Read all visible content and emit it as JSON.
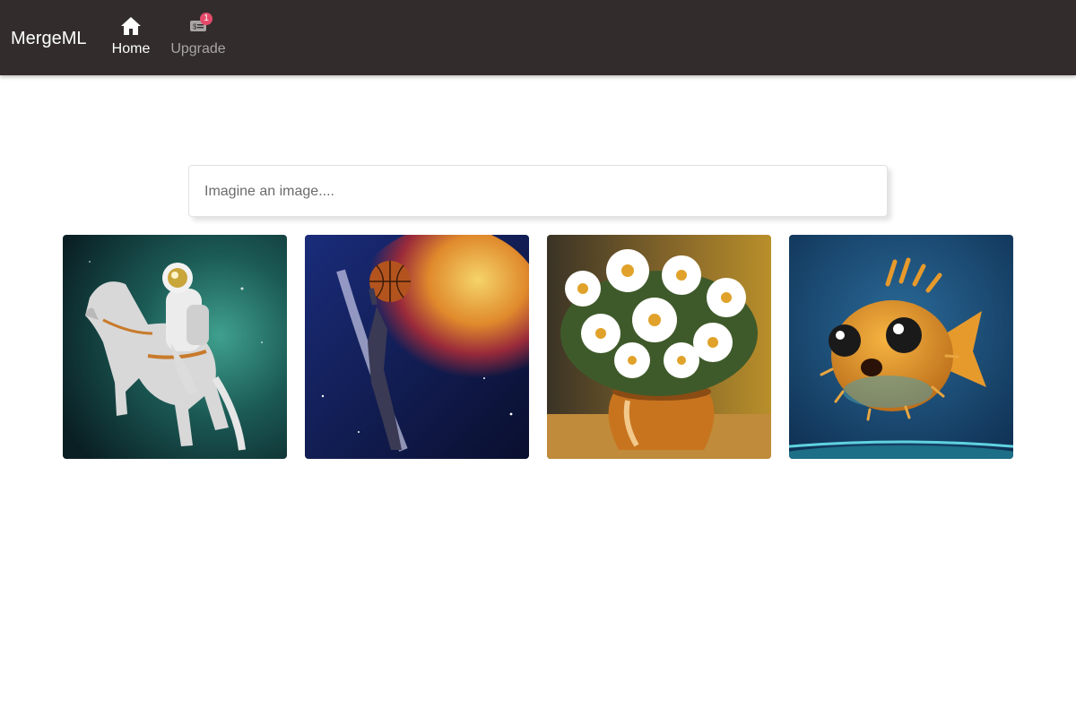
{
  "navbar": {
    "brand": "MergeML",
    "items": [
      {
        "label": "Home",
        "icon": "home-icon",
        "active": true
      },
      {
        "label": "Upgrade",
        "icon": "ticket-icon",
        "badge": "1",
        "active": false
      }
    ]
  },
  "search": {
    "placeholder": "Imagine an image....",
    "value": ""
  },
  "gallery": {
    "items": [
      {
        "subject": "astronaut-riding-horse"
      },
      {
        "subject": "basketball-player-in-space"
      },
      {
        "subject": "daisies-in-vase-painting"
      },
      {
        "subject": "pufferfish-3d"
      }
    ]
  },
  "colors": {
    "navbar_bg": "#322c2c",
    "badge": "#e34a6a",
    "inactive_nav": "#a9a5a5"
  }
}
